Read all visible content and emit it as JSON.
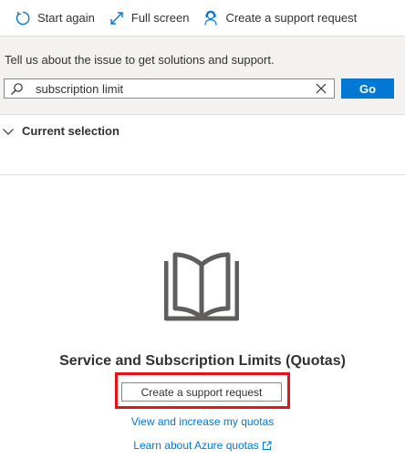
{
  "toolbar": {
    "start_again": "Start again",
    "full_screen": "Full screen",
    "create_support": "Create a support request"
  },
  "search": {
    "prompt": "Tell us about the issue to get solutions and support.",
    "value": "subscription limit",
    "go_label": "Go"
  },
  "current_selection": {
    "title": "Current selection"
  },
  "result": {
    "title": "Service and Subscription Limits (Quotas)",
    "support_button": "Create a support request",
    "link_quotas": "View and increase my quotas",
    "link_learn": "Learn about Azure quotas"
  },
  "colors": {
    "accent": "#0078d4",
    "highlight": "#e8121b",
    "icon_gray": "#605e5c"
  },
  "icons": [
    "refresh-icon",
    "expand-icon",
    "person-support-icon",
    "search-icon",
    "clear-icon",
    "chevron-down-icon",
    "book-icon",
    "external-link-icon"
  ]
}
